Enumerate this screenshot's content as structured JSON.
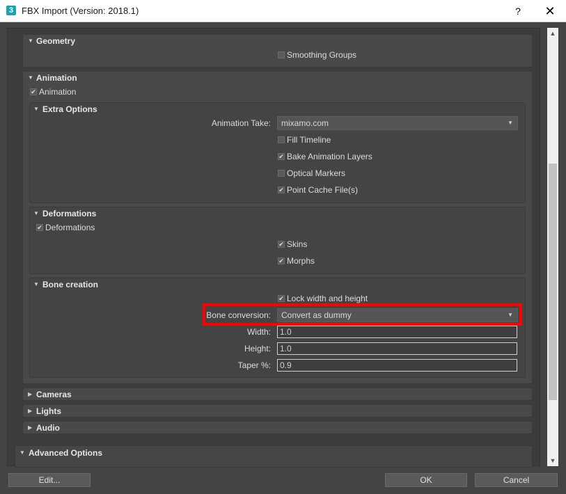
{
  "window": {
    "app_icon_text": "3",
    "title": "FBX Import (Version: 2018.1)",
    "help_label": "?",
    "close_label": "✕"
  },
  "geometry": {
    "title": "Geometry",
    "smoothing_groups": {
      "label": "Smoothing Groups",
      "checked": false
    }
  },
  "animation": {
    "title": "Animation",
    "animation_checkbox": {
      "label": "Animation",
      "checked": true
    },
    "extra_options": {
      "title": "Extra Options",
      "take_label": "Animation Take:",
      "take_value": "mixamo.com",
      "fill_timeline": {
        "label": "Fill Timeline",
        "checked": false
      },
      "bake_layers": {
        "label": "Bake Animation Layers",
        "checked": true
      },
      "optical_markers": {
        "label": "Optical Markers",
        "checked": false
      },
      "point_cache": {
        "label": "Point Cache File(s)",
        "checked": true
      }
    },
    "deformations": {
      "title": "Deformations",
      "deformations_checkbox": {
        "label": "Deformations",
        "checked": true
      },
      "skins": {
        "label": "Skins",
        "checked": true
      },
      "morphs": {
        "label": "Morphs",
        "checked": true
      }
    },
    "bone_creation": {
      "title": "Bone creation",
      "lock_wh": {
        "label": "Lock width and height",
        "checked": true
      },
      "conversion_label": "Bone conversion:",
      "conversion_value": "Convert as dummy",
      "width_label": "Width:",
      "width_value": "1.0",
      "height_label": "Height:",
      "height_value": "1.0",
      "taper_label": "Taper %:",
      "taper_value": "0.9"
    }
  },
  "collapsed": {
    "cameras": "Cameras",
    "lights": "Lights",
    "audio": "Audio"
  },
  "advanced_options": {
    "title": "Advanced Options"
  },
  "footer": {
    "edit_label": "Edit...",
    "ok_label": "OK",
    "cancel_label": "Cancel"
  },
  "glyphs": {
    "expanded": "▼",
    "collapsed": "▶",
    "check": "✔",
    "dropdown": "▼",
    "scroll_up": "▲",
    "scroll_down": "▼"
  },
  "colors": {
    "highlight": "#ff0000",
    "panel_bg": "#444444",
    "titlebar_bg": "#ffffff"
  }
}
